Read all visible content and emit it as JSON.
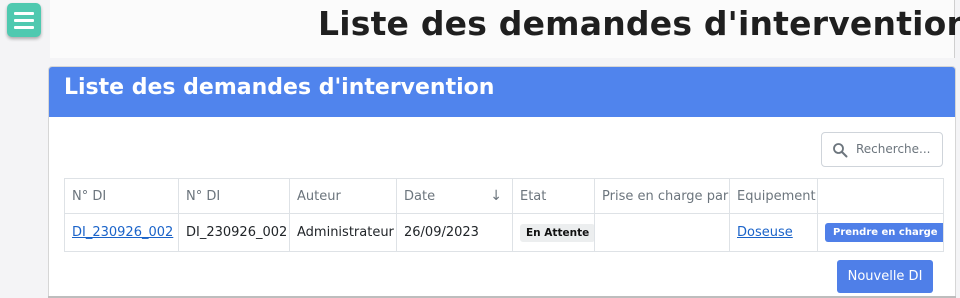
{
  "page": {
    "title": "Liste des demandes d'intervention"
  },
  "card": {
    "title": "Liste des demandes d'intervention"
  },
  "search": {
    "placeholder": "Recherche..."
  },
  "table": {
    "columns": [
      "N° DI",
      "N° DI",
      "Auteur",
      "Date",
      "Etat",
      "Prise en charge par",
      "Equipement",
      ""
    ],
    "rows": [
      {
        "di_link": "DI_230926_002",
        "di": "DI_230926_002",
        "author": "Administrateur",
        "date": "26/09/2023",
        "status": "En Attente",
        "taken_by": "",
        "equipment": "Doseuse",
        "action": "Prendre en charge"
      }
    ]
  },
  "actions": {
    "new_label": "Nouvelle DI"
  },
  "colors": {
    "menu": "#4fc9b0",
    "header": "#5084ed",
    "button": "#4f7fe8",
    "link": "#1a63c9"
  },
  "icons": {
    "menu": "hamburger-icon",
    "search": "search-icon",
    "sort": "sort-down-icon"
  }
}
